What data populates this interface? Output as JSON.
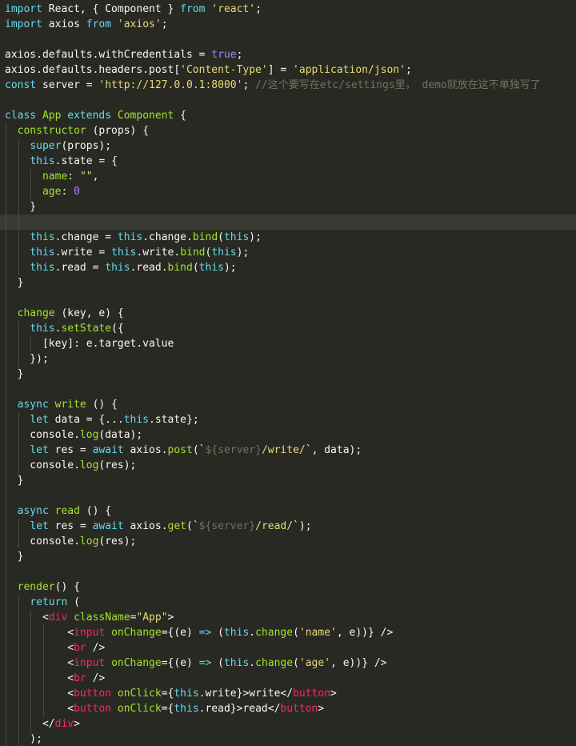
{
  "editor": {
    "theme": "monokai-like",
    "colors": {
      "background": "#282923",
      "keyword": "#66d9ef",
      "plain": "#f8f8f2",
      "string": "#e6db74",
      "number": "#ae81ff",
      "function": "#a6e22e",
      "comment": "#75715e",
      "tag": "#f92672"
    },
    "active_line": 14,
    "lines": [
      {
        "indent": 0,
        "tokens": [
          [
            "kw",
            "import"
          ],
          [
            "pl",
            " React, { Component } "
          ],
          [
            "kw",
            "from"
          ],
          [
            "pl",
            " "
          ],
          [
            "st",
            "'react'"
          ],
          [
            "pl",
            ";"
          ]
        ]
      },
      {
        "indent": 0,
        "tokens": [
          [
            "kw",
            "import"
          ],
          [
            "pl",
            " axios "
          ],
          [
            "kw",
            "from"
          ],
          [
            "pl",
            " "
          ],
          [
            "st",
            "'axios'"
          ],
          [
            "pl",
            ";"
          ]
        ]
      },
      {
        "indent": 0,
        "tokens": []
      },
      {
        "indent": 0,
        "tokens": [
          [
            "pl",
            "axios.defaults.withCredentials = "
          ],
          [
            "nu",
            "true"
          ],
          [
            "pl",
            ";"
          ]
        ]
      },
      {
        "indent": 0,
        "tokens": [
          [
            "pl",
            "axios.defaults.headers.post["
          ],
          [
            "st",
            "'Content-Type'"
          ],
          [
            "pl",
            "] = "
          ],
          [
            "st",
            "'application/json'"
          ],
          [
            "pl",
            ";"
          ]
        ]
      },
      {
        "indent": 0,
        "tokens": [
          [
            "kw",
            "const"
          ],
          [
            "pl",
            " server = "
          ],
          [
            "st",
            "'http://127.0.0.1:8000'"
          ],
          [
            "pl",
            "; "
          ],
          [
            "cm",
            "//这个要写在etc/settings里， demo就放在这不单独写了"
          ]
        ]
      },
      {
        "indent": 0,
        "tokens": []
      },
      {
        "indent": 0,
        "tokens": [
          [
            "kw",
            "class"
          ],
          [
            "pl",
            " "
          ],
          [
            "fn",
            "App"
          ],
          [
            "pl",
            " "
          ],
          [
            "kw",
            "extends"
          ],
          [
            "pl",
            " "
          ],
          [
            "fn",
            "Component"
          ],
          [
            "pl",
            " {"
          ]
        ]
      },
      {
        "indent": 1,
        "tokens": [
          [
            "pl",
            "  "
          ],
          [
            "fn",
            "constructor"
          ],
          [
            "pl",
            " (props) {"
          ]
        ]
      },
      {
        "indent": 2,
        "tokens": [
          [
            "pl",
            "    "
          ],
          [
            "kw",
            "super"
          ],
          [
            "pl",
            "(props);"
          ]
        ]
      },
      {
        "indent": 2,
        "tokens": [
          [
            "pl",
            "    "
          ],
          [
            "kw",
            "this"
          ],
          [
            "pl",
            ".state = {"
          ]
        ]
      },
      {
        "indent": 3,
        "tokens": [
          [
            "pl",
            "      "
          ],
          [
            "fn",
            "name"
          ],
          [
            "pl",
            ": "
          ],
          [
            "st",
            "\"\""
          ],
          [
            "pl",
            ","
          ]
        ]
      },
      {
        "indent": 3,
        "tokens": [
          [
            "pl",
            "      "
          ],
          [
            "fn",
            "age"
          ],
          [
            "pl",
            ": "
          ],
          [
            "nu",
            "0"
          ]
        ]
      },
      {
        "indent": 2,
        "tokens": [
          [
            "pl",
            "    }"
          ]
        ]
      },
      {
        "indent": 2,
        "tokens": []
      },
      {
        "indent": 2,
        "tokens": [
          [
            "pl",
            "    "
          ],
          [
            "kw",
            "this"
          ],
          [
            "pl",
            ".change = "
          ],
          [
            "kw",
            "this"
          ],
          [
            "pl",
            ".change."
          ],
          [
            "fn",
            "bind"
          ],
          [
            "pl",
            "("
          ],
          [
            "kw",
            "this"
          ],
          [
            "pl",
            ");"
          ]
        ]
      },
      {
        "indent": 2,
        "tokens": [
          [
            "pl",
            "    "
          ],
          [
            "kw",
            "this"
          ],
          [
            "pl",
            ".write = "
          ],
          [
            "kw",
            "this"
          ],
          [
            "pl",
            ".write."
          ],
          [
            "fn",
            "bind"
          ],
          [
            "pl",
            "("
          ],
          [
            "kw",
            "this"
          ],
          [
            "pl",
            ");"
          ]
        ]
      },
      {
        "indent": 2,
        "tokens": [
          [
            "pl",
            "    "
          ],
          [
            "kw",
            "this"
          ],
          [
            "pl",
            ".read = "
          ],
          [
            "kw",
            "this"
          ],
          [
            "pl",
            ".read."
          ],
          [
            "fn",
            "bind"
          ],
          [
            "pl",
            "("
          ],
          [
            "kw",
            "this"
          ],
          [
            "pl",
            ");"
          ]
        ]
      },
      {
        "indent": 1,
        "tokens": [
          [
            "pl",
            "  }"
          ]
        ]
      },
      {
        "indent": 1,
        "tokens": []
      },
      {
        "indent": 1,
        "tokens": [
          [
            "pl",
            "  "
          ],
          [
            "fn",
            "change"
          ],
          [
            "pl",
            " (key, e) {"
          ]
        ]
      },
      {
        "indent": 2,
        "tokens": [
          [
            "pl",
            "    "
          ],
          [
            "kw",
            "this"
          ],
          [
            "pl",
            "."
          ],
          [
            "fn",
            "setState"
          ],
          [
            "pl",
            "({"
          ]
        ]
      },
      {
        "indent": 3,
        "tokens": [
          [
            "pl",
            "      [key]: e.target.value"
          ]
        ]
      },
      {
        "indent": 2,
        "tokens": [
          [
            "pl",
            "    });"
          ]
        ]
      },
      {
        "indent": 1,
        "tokens": [
          [
            "pl",
            "  }"
          ]
        ]
      },
      {
        "indent": 1,
        "tokens": []
      },
      {
        "indent": 1,
        "tokens": [
          [
            "pl",
            "  "
          ],
          [
            "kw",
            "async"
          ],
          [
            "pl",
            " "
          ],
          [
            "fn",
            "write"
          ],
          [
            "pl",
            " () {"
          ]
        ]
      },
      {
        "indent": 2,
        "tokens": [
          [
            "pl",
            "    "
          ],
          [
            "kw",
            "let"
          ],
          [
            "pl",
            " data = {..."
          ],
          [
            "kw",
            "this"
          ],
          [
            "pl",
            ".state};"
          ]
        ]
      },
      {
        "indent": 2,
        "tokens": [
          [
            "pl",
            "    console."
          ],
          [
            "fn",
            "log"
          ],
          [
            "pl",
            "(data);"
          ]
        ]
      },
      {
        "indent": 2,
        "tokens": [
          [
            "pl",
            "    "
          ],
          [
            "kw",
            "let"
          ],
          [
            "pl",
            " res = "
          ],
          [
            "kw",
            "await"
          ],
          [
            "pl",
            " axios."
          ],
          [
            "fn",
            "post"
          ],
          [
            "pl",
            "(`"
          ],
          [
            "cm",
            "${server}"
          ],
          [
            "st",
            "/write/"
          ],
          [
            "pl",
            "`, data);"
          ]
        ]
      },
      {
        "indent": 2,
        "tokens": [
          [
            "pl",
            "    console."
          ],
          [
            "fn",
            "log"
          ],
          [
            "pl",
            "(res);"
          ]
        ]
      },
      {
        "indent": 1,
        "tokens": [
          [
            "pl",
            "  }"
          ]
        ]
      },
      {
        "indent": 1,
        "tokens": []
      },
      {
        "indent": 1,
        "tokens": [
          [
            "pl",
            "  "
          ],
          [
            "kw",
            "async"
          ],
          [
            "pl",
            " "
          ],
          [
            "fn",
            "read"
          ],
          [
            "pl",
            " () {"
          ]
        ]
      },
      {
        "indent": 2,
        "tokens": [
          [
            "pl",
            "    "
          ],
          [
            "kw",
            "let"
          ],
          [
            "pl",
            " res = "
          ],
          [
            "kw",
            "await"
          ],
          [
            "pl",
            " axios."
          ],
          [
            "fn",
            "get"
          ],
          [
            "pl",
            "(`"
          ],
          [
            "cm",
            "${server}"
          ],
          [
            "st",
            "/read/"
          ],
          [
            "pl",
            "`);"
          ]
        ]
      },
      {
        "indent": 2,
        "tokens": [
          [
            "pl",
            "    console."
          ],
          [
            "fn",
            "log"
          ],
          [
            "pl",
            "(res);"
          ]
        ]
      },
      {
        "indent": 1,
        "tokens": [
          [
            "pl",
            "  }"
          ]
        ]
      },
      {
        "indent": 1,
        "tokens": []
      },
      {
        "indent": 1,
        "tokens": [
          [
            "pl",
            "  "
          ],
          [
            "fn",
            "render"
          ],
          [
            "pl",
            "() {"
          ]
        ]
      },
      {
        "indent": 2,
        "tokens": [
          [
            "pl",
            "    "
          ],
          [
            "kw",
            "return"
          ],
          [
            "pl",
            " ("
          ]
        ]
      },
      {
        "indent": 3,
        "tokens": [
          [
            "pl",
            "      <"
          ],
          [
            "tg",
            "div"
          ],
          [
            "pl",
            " "
          ],
          [
            "at",
            "className"
          ],
          [
            "pl",
            "="
          ],
          [
            "st",
            "\"App\""
          ],
          [
            "pl",
            ">"
          ]
        ]
      },
      {
        "indent": 4,
        "tokens": [
          [
            "pl",
            "          <"
          ],
          [
            "tg",
            "input"
          ],
          [
            "pl",
            " "
          ],
          [
            "at",
            "onChange"
          ],
          [
            "pl",
            "={(e) "
          ],
          [
            "kw",
            "=>"
          ],
          [
            "pl",
            " ("
          ],
          [
            "kw",
            "this"
          ],
          [
            "pl",
            "."
          ],
          [
            "fn",
            "change"
          ],
          [
            "pl",
            "("
          ],
          [
            "st",
            "'name'"
          ],
          [
            "pl",
            ", e))} />"
          ]
        ]
      },
      {
        "indent": 4,
        "tokens": [
          [
            "pl",
            "          <"
          ],
          [
            "tg",
            "br"
          ],
          [
            "pl",
            " />"
          ]
        ]
      },
      {
        "indent": 4,
        "tokens": [
          [
            "pl",
            "          <"
          ],
          [
            "tg",
            "input"
          ],
          [
            "pl",
            " "
          ],
          [
            "at",
            "onChange"
          ],
          [
            "pl",
            "={(e) "
          ],
          [
            "kw",
            "=>"
          ],
          [
            "pl",
            " ("
          ],
          [
            "kw",
            "this"
          ],
          [
            "pl",
            "."
          ],
          [
            "fn",
            "change"
          ],
          [
            "pl",
            "("
          ],
          [
            "st",
            "'age'"
          ],
          [
            "pl",
            ", e))} />"
          ]
        ]
      },
      {
        "indent": 4,
        "tokens": [
          [
            "pl",
            "          <"
          ],
          [
            "tg",
            "br"
          ],
          [
            "pl",
            " />"
          ]
        ]
      },
      {
        "indent": 4,
        "tokens": [
          [
            "pl",
            "          <"
          ],
          [
            "tg",
            "button"
          ],
          [
            "pl",
            " "
          ],
          [
            "at",
            "onClick"
          ],
          [
            "pl",
            "={"
          ],
          [
            "kw",
            "this"
          ],
          [
            "pl",
            ".write}>write</"
          ],
          [
            "tg",
            "button"
          ],
          [
            "pl",
            ">"
          ]
        ]
      },
      {
        "indent": 4,
        "tokens": [
          [
            "pl",
            "          <"
          ],
          [
            "tg",
            "button"
          ],
          [
            "pl",
            " "
          ],
          [
            "at",
            "onClick"
          ],
          [
            "pl",
            "={"
          ],
          [
            "kw",
            "this"
          ],
          [
            "pl",
            ".read}>read</"
          ],
          [
            "tg",
            "button"
          ],
          [
            "pl",
            ">"
          ]
        ]
      },
      {
        "indent": 3,
        "tokens": [
          [
            "pl",
            "      </"
          ],
          [
            "tg",
            "div"
          ],
          [
            "pl",
            ">"
          ]
        ]
      },
      {
        "indent": 2,
        "tokens": [
          [
            "pl",
            "    );"
          ]
        ]
      }
    ]
  }
}
